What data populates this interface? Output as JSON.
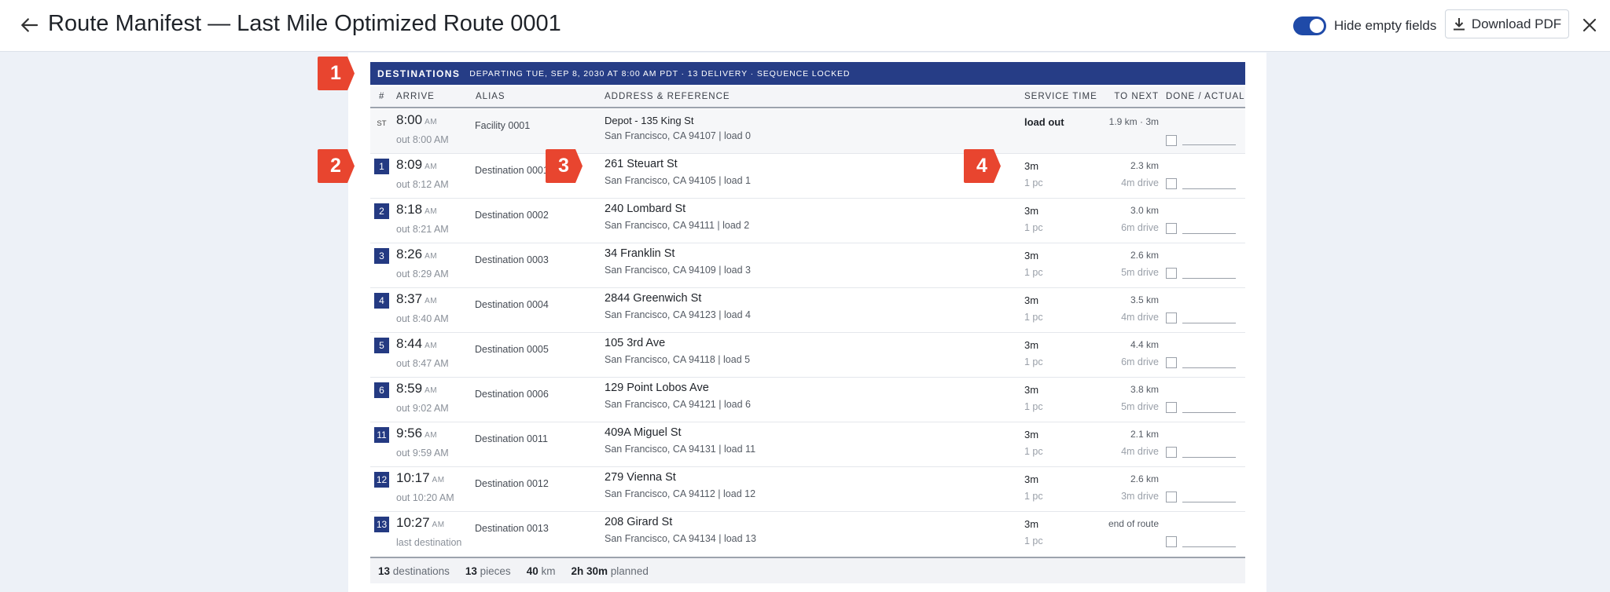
{
  "topbar": {
    "title": "Route Manifest — Last Mile Optimized Route 0001",
    "toggle_label": "Hide empty fields",
    "toggle_on": true,
    "download_label": "Download PDF",
    "colors": {
      "accent": "#1f4aa8",
      "header": "#263d86",
      "callout": "#e8452f"
    }
  },
  "table": {
    "header_title": "DESTINATIONS",
    "header_subtitle": "DEPARTING TUE, SEP 8, 2030 AT 8:00 AM PDT · 13 DELIVERY · SEQUENCE LOCKED",
    "columns": [
      "#",
      "ARRIVE",
      "ALIAS",
      "ADDRESS & REFERENCE",
      "SERVICE TIME",
      "TO NEXT",
      "DONE / ACTUAL"
    ],
    "start_row": {
      "marker": "ST",
      "arrive": "8:00",
      "ampm": "AM",
      "out": "out 8:00 AM",
      "alias": "Facility 0001",
      "address": "Depot - 135 King St",
      "reference": "San Francisco, CA 94107 | load 0",
      "service": "load out",
      "to_next": "1.9 km · 3m"
    },
    "rows": [
      {
        "num": "1",
        "arrive": "8:09",
        "ampm": "AM",
        "out": "out 8:12 AM",
        "alias": "Destination 0001",
        "address": "261 Steuart St",
        "reference": "San Francisco, CA 94105 | load 1",
        "service": "3m",
        "pieces": "1 pc",
        "distance": "2.3 km",
        "drive": "4m drive"
      },
      {
        "num": "2",
        "arrive": "8:18",
        "ampm": "AM",
        "out": "out 8:21 AM",
        "alias": "Destination 0002",
        "address": "240 Lombard St",
        "reference": "San Francisco, CA 94111 | load 2",
        "service": "3m",
        "pieces": "1 pc",
        "distance": "3.0 km",
        "drive": "6m drive"
      },
      {
        "num": "3",
        "arrive": "8:26",
        "ampm": "AM",
        "out": "out 8:29 AM",
        "alias": "Destination 0003",
        "address": "34 Franklin St",
        "reference": "San Francisco, CA 94109 | load 3",
        "service": "3m",
        "pieces": "1 pc",
        "distance": "2.6 km",
        "drive": "5m drive"
      },
      {
        "num": "4",
        "arrive": "8:37",
        "ampm": "AM",
        "out": "out 8:40 AM",
        "alias": "Destination 0004",
        "address": "2844 Greenwich St",
        "reference": "San Francisco, CA 94123 | load 4",
        "service": "3m",
        "pieces": "1 pc",
        "distance": "3.5 km",
        "drive": "4m drive"
      },
      {
        "num": "5",
        "arrive": "8:44",
        "ampm": "AM",
        "out": "out 8:47 AM",
        "alias": "Destination 0005",
        "address": "105 3rd Ave",
        "reference": "San Francisco, CA 94118 | load 5",
        "service": "3m",
        "pieces": "1 pc",
        "distance": "4.4 km",
        "drive": "6m drive"
      },
      {
        "num": "6",
        "arrive": "8:59",
        "ampm": "AM",
        "out": "out 9:02 AM",
        "alias": "Destination 0006",
        "address": "129 Point Lobos Ave",
        "reference": "San Francisco, CA 94121 | load 6",
        "service": "3m",
        "pieces": "1 pc",
        "distance": "3.8 km",
        "drive": "5m drive"
      },
      {
        "num": "11",
        "arrive": "9:56",
        "ampm": "AM",
        "out": "out 9:59 AM",
        "alias": "Destination 0011",
        "address": "409A Miguel St",
        "reference": "San Francisco, CA 94131 | load 11",
        "service": "3m",
        "pieces": "1 pc",
        "distance": "2.1 km",
        "drive": "4m drive"
      },
      {
        "num": "12",
        "arrive": "10:17",
        "ampm": "AM",
        "out": "out 10:20 AM",
        "alias": "Destination 0012",
        "address": "279 Vienna St",
        "reference": "San Francisco, CA 94112 | load 12",
        "service": "3m",
        "pieces": "1 pc",
        "distance": "2.6 km",
        "drive": "3m drive"
      },
      {
        "num": "13",
        "arrive": "10:27",
        "ampm": "AM",
        "out": "last destination",
        "alias": "Destination 0013",
        "address": "208 Girard St",
        "reference": "San Francisco, CA 94134 | load 13",
        "service": "3m",
        "pieces": "1 pc",
        "distance": "end of route",
        "drive": ""
      }
    ],
    "footer": {
      "destinations_value": "13",
      "destinations_label": "destinations",
      "pieces_value": "13",
      "pieces_label": "pieces",
      "distance_value": "40",
      "distance_label": "km",
      "planned_value": "2h 30m",
      "planned_label": "planned"
    }
  },
  "callouts": [
    "1",
    "2",
    "3",
    "4"
  ]
}
